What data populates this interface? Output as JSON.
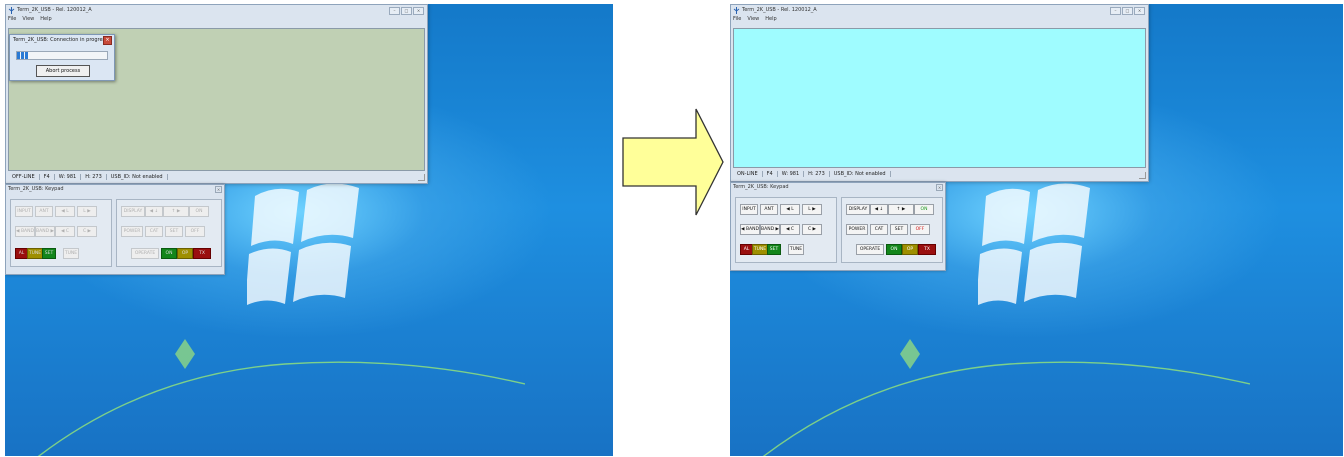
{
  "colors": {
    "screen_offline": "#c0d0b4",
    "screen_online": "#9ffcff",
    "arrow_fill": "#ffff99",
    "desktop_blue": "#1e8fe0"
  },
  "arrow": {
    "icon": "right-arrow-icon"
  },
  "left": {
    "main_window": {
      "title": "Term_2K_USB - Rel. 120012_A",
      "menu": [
        "File",
        "View",
        "Help"
      ],
      "status": [
        "OFF-LINE",
        "F4",
        "W: 981",
        "H: 273",
        "USB_ID: Not enabled"
      ]
    },
    "dialog": {
      "title": "Term_2K_USB: Connection in progress...",
      "progress": 0.12,
      "abort_label": "Abort process"
    },
    "keypad": {
      "title": "Term_2K_USB: Keypad",
      "group1": {
        "row1": [
          "INPUT",
          "ANT",
          "◀ L",
          "L ▶"
        ],
        "row2": [
          "◀ BAND",
          "BAND ▶",
          "◀ C",
          "C ▶"
        ],
        "row3": [
          "AL",
          "TUNE",
          "SET",
          "TUNE"
        ]
      },
      "group2": {
        "row1": [
          "DISPLAY",
          "◀ ↓",
          "↑ ▶",
          "ON"
        ],
        "row2": [
          "POWER",
          "CAT",
          "SET",
          "OFF"
        ],
        "row3": [
          "OPERATE",
          "ON",
          "OP",
          "TX"
        ]
      }
    }
  },
  "right": {
    "main_window": {
      "title": "Term_2K_USB - Rel. 120012_A",
      "menu": [
        "File",
        "View",
        "Help"
      ],
      "status": [
        "ON-LINE",
        "F4",
        "W: 981",
        "H: 273",
        "USB_ID: Not enabled"
      ]
    },
    "keypad": {
      "title": "Term_2K_USB: Keypad",
      "group1": {
        "row1": [
          "INPUT",
          "ANT",
          "◀ L",
          "L ▶"
        ],
        "row2": [
          "◀ BAND",
          "BAND ▶",
          "◀ C",
          "C ▶"
        ],
        "row3": [
          "AL",
          "TUNE",
          "SET",
          "TUNE"
        ]
      },
      "group2": {
        "row1": [
          "DISPLAY",
          "◀ ↓",
          "↑ ▶",
          "ON"
        ],
        "row2": [
          "POWER",
          "CAT",
          "SET",
          "OFF"
        ],
        "row3": [
          "OPERATE",
          "ON",
          "OP",
          "TX"
        ]
      }
    }
  }
}
